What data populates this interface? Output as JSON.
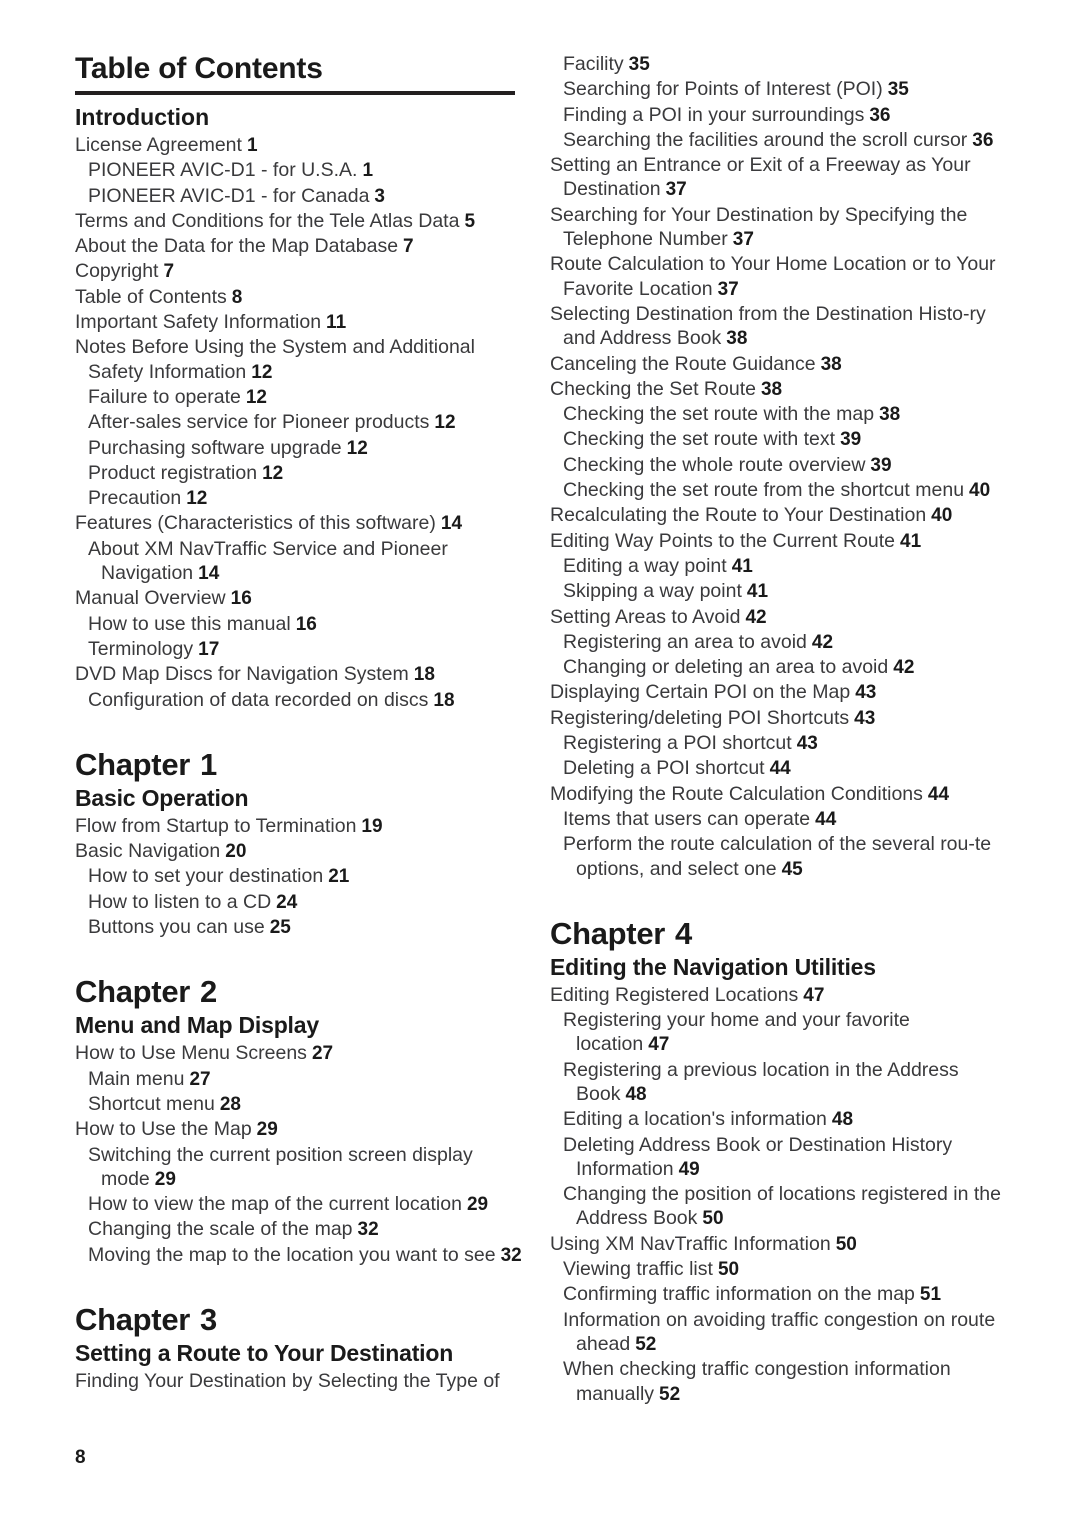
{
  "document": {
    "title": "Table of Contents",
    "folio": "8"
  },
  "left_column": {
    "sections": [
      {
        "kind": "section",
        "heading": "Introduction",
        "entries": [
          {
            "level": 1,
            "text": "License Agreement",
            "page": "1"
          },
          {
            "level": 2,
            "text": "PIONEER AVIC-D1 - for U.S.A.",
            "page": "1"
          },
          {
            "level": 2,
            "text": "PIONEER AVIC-D1 - for Canada",
            "page": "3"
          },
          {
            "level": 1,
            "text": "Terms and Conditions for the Tele Atlas Data",
            "page": "5"
          },
          {
            "level": 1,
            "text": "About the Data for the Map Database",
            "page": "7"
          },
          {
            "level": 1,
            "text": "Copyright",
            "page": "7"
          },
          {
            "level": 1,
            "text": "Table of Contents",
            "page": "8"
          },
          {
            "level": 1,
            "text": "Important Safety Information",
            "page": "11"
          },
          {
            "level": 1,
            "text": "Notes Before Using the System and Additional Safety Information",
            "page": "12"
          },
          {
            "level": 2,
            "text": "Failure to operate",
            "page": "12"
          },
          {
            "level": 2,
            "text": "After-sales service for Pioneer products",
            "page": "12"
          },
          {
            "level": 2,
            "text": "Purchasing software upgrade",
            "page": "12"
          },
          {
            "level": 2,
            "text": "Product registration",
            "page": "12"
          },
          {
            "level": 2,
            "text": "Precaution",
            "page": "12"
          },
          {
            "level": 1,
            "text": "Features (Characteristics of this software)",
            "page": "14"
          },
          {
            "level": 2,
            "text": "About XM NavTraffic Service and Pioneer Navigation",
            "page": "14"
          },
          {
            "level": 1,
            "text": "Manual Overview",
            "page": "16"
          },
          {
            "level": 2,
            "text": "How to use this manual",
            "page": "16"
          },
          {
            "level": 2,
            "text": "Terminology",
            "page": "17"
          },
          {
            "level": 1,
            "text": "DVD Map Discs for Navigation System",
            "page": "18"
          },
          {
            "level": 2,
            "text": "Configuration of data recorded on discs",
            "page": "18"
          }
        ]
      },
      {
        "kind": "chapter",
        "chapter_word": "Chapter",
        "chapter_number": "1",
        "chapter_title": "Basic Operation",
        "entries": [
          {
            "level": 1,
            "text": "Flow from Startup to Termination",
            "page": "19"
          },
          {
            "level": 1,
            "text": "Basic Navigation",
            "page": "20"
          },
          {
            "level": 2,
            "text": "How to set your destination",
            "page": "21"
          },
          {
            "level": 2,
            "text": "How to listen to a CD",
            "page": "24"
          },
          {
            "level": 2,
            "text": "Buttons you can use",
            "page": "25"
          }
        ]
      },
      {
        "kind": "chapter",
        "chapter_word": "Chapter",
        "chapter_number": "2",
        "chapter_title": "Menu and Map Display",
        "entries": [
          {
            "level": 1,
            "text": "How to Use Menu Screens",
            "page": "27"
          },
          {
            "level": 2,
            "text": "Main menu",
            "page": "27"
          },
          {
            "level": 2,
            "text": "Shortcut menu",
            "page": "28"
          },
          {
            "level": 1,
            "text": "How to Use the Map",
            "page": "29"
          },
          {
            "level": 2,
            "text": "Switching the current position screen display mode",
            "page": "29"
          },
          {
            "level": 2,
            "text": "How to view the map of the current location",
            "page": "29"
          },
          {
            "level": 2,
            "text": "Changing the scale of the map",
            "page": "32"
          },
          {
            "level": 2,
            "text": "Moving the map to the location you want to see",
            "page": "32"
          }
        ]
      },
      {
        "kind": "chapter",
        "chapter_word": "Chapter",
        "chapter_number": "3",
        "chapter_title": "Setting a Route to Your Destination",
        "entries": [
          {
            "level": 1,
            "text": "Finding Your Destination by Selecting the Type of",
            "page": ""
          }
        ]
      }
    ]
  },
  "right_column": {
    "sections": [
      {
        "kind": "continuation",
        "entries": [
          {
            "level": 2,
            "text": "Facility",
            "page": "35",
            "continued": true
          },
          {
            "level": 2,
            "text": "Searching for Points of Interest (POI)",
            "page": "35"
          },
          {
            "level": 2,
            "text": "Finding a POI in your surroundings",
            "page": "36"
          },
          {
            "level": 2,
            "text": "Searching the facilities around the scroll cursor",
            "page": "36"
          },
          {
            "level": 1,
            "text": "Setting an Entrance or Exit of a Freeway as Your Destination",
            "page": "37"
          },
          {
            "level": 1,
            "text": "Searching for Your Destination by Specifying the Telephone Number",
            "page": "37"
          },
          {
            "level": 1,
            "text": "Route Calculation to Your Home Location or to Your Favorite Location",
            "page": "37"
          },
          {
            "level": 1,
            "text": "Selecting Destination from the Destination Histo-ry and Address Book",
            "page": "38"
          },
          {
            "level": 1,
            "text": "Canceling the Route Guidance",
            "page": "38"
          },
          {
            "level": 1,
            "text": "Checking the Set Route",
            "page": "38"
          },
          {
            "level": 2,
            "text": "Checking the set route with the map",
            "page": "38"
          },
          {
            "level": 2,
            "text": "Checking the set route with text",
            "page": "39"
          },
          {
            "level": 2,
            "text": "Checking the whole route overview",
            "page": "39"
          },
          {
            "level": 2,
            "text": "Checking the set route from the shortcut menu",
            "page": "40"
          },
          {
            "level": 1,
            "text": "Recalculating the Route to Your Destination",
            "page": "40"
          },
          {
            "level": 1,
            "text": "Editing Way Points to the Current Route",
            "page": "41"
          },
          {
            "level": 2,
            "text": "Editing a way point",
            "page": "41"
          },
          {
            "level": 2,
            "text": "Skipping a way point",
            "page": "41"
          },
          {
            "level": 1,
            "text": "Setting Areas to Avoid",
            "page": "42"
          },
          {
            "level": 2,
            "text": "Registering an area to avoid",
            "page": "42"
          },
          {
            "level": 2,
            "text": "Changing or deleting an area to avoid",
            "page": "42"
          },
          {
            "level": 1,
            "text": "Displaying Certain POI on the Map",
            "page": "43"
          },
          {
            "level": 1,
            "text": "Registering/deleting POI Shortcuts",
            "page": "43"
          },
          {
            "level": 2,
            "text": "Registering a POI shortcut",
            "page": "43"
          },
          {
            "level": 2,
            "text": "Deleting a POI shortcut",
            "page": "44"
          },
          {
            "level": 1,
            "text": "Modifying the Route Calculation Conditions",
            "page": "44"
          },
          {
            "level": 2,
            "text": "Items that users can operate",
            "page": "44"
          },
          {
            "level": 2,
            "text": "Perform the route calculation of the several rou-te options, and select one",
            "page": "45"
          }
        ]
      },
      {
        "kind": "chapter",
        "chapter_word": "Chapter",
        "chapter_number": "4",
        "chapter_title": "Editing the Navigation Utilities",
        "entries": [
          {
            "level": 1,
            "text": "Editing Registered Locations",
            "page": "47"
          },
          {
            "level": 2,
            "text": "Registering your home and your favorite location",
            "page": "47"
          },
          {
            "level": 2,
            "text": "Registering a previous location in the Address Book",
            "page": "48"
          },
          {
            "level": 2,
            "text": "Editing a location's information",
            "page": "48"
          },
          {
            "level": 2,
            "text": "Deleting Address Book or Destination History Information",
            "page": "49"
          },
          {
            "level": 2,
            "text": "Changing the position of locations registered in the Address Book",
            "page": "50"
          },
          {
            "level": 1,
            "text": "Using XM NavTraffic Information",
            "page": "50"
          },
          {
            "level": 2,
            "text": "Viewing traffic list",
            "page": "50"
          },
          {
            "level": 2,
            "text": "Confirming traffic information on the map",
            "page": "51"
          },
          {
            "level": 2,
            "text": "Information on avoiding traffic congestion on route ahead",
            "page": "52"
          },
          {
            "level": 2,
            "text": "When checking traffic congestion information manually",
            "page": "52"
          }
        ]
      }
    ]
  }
}
